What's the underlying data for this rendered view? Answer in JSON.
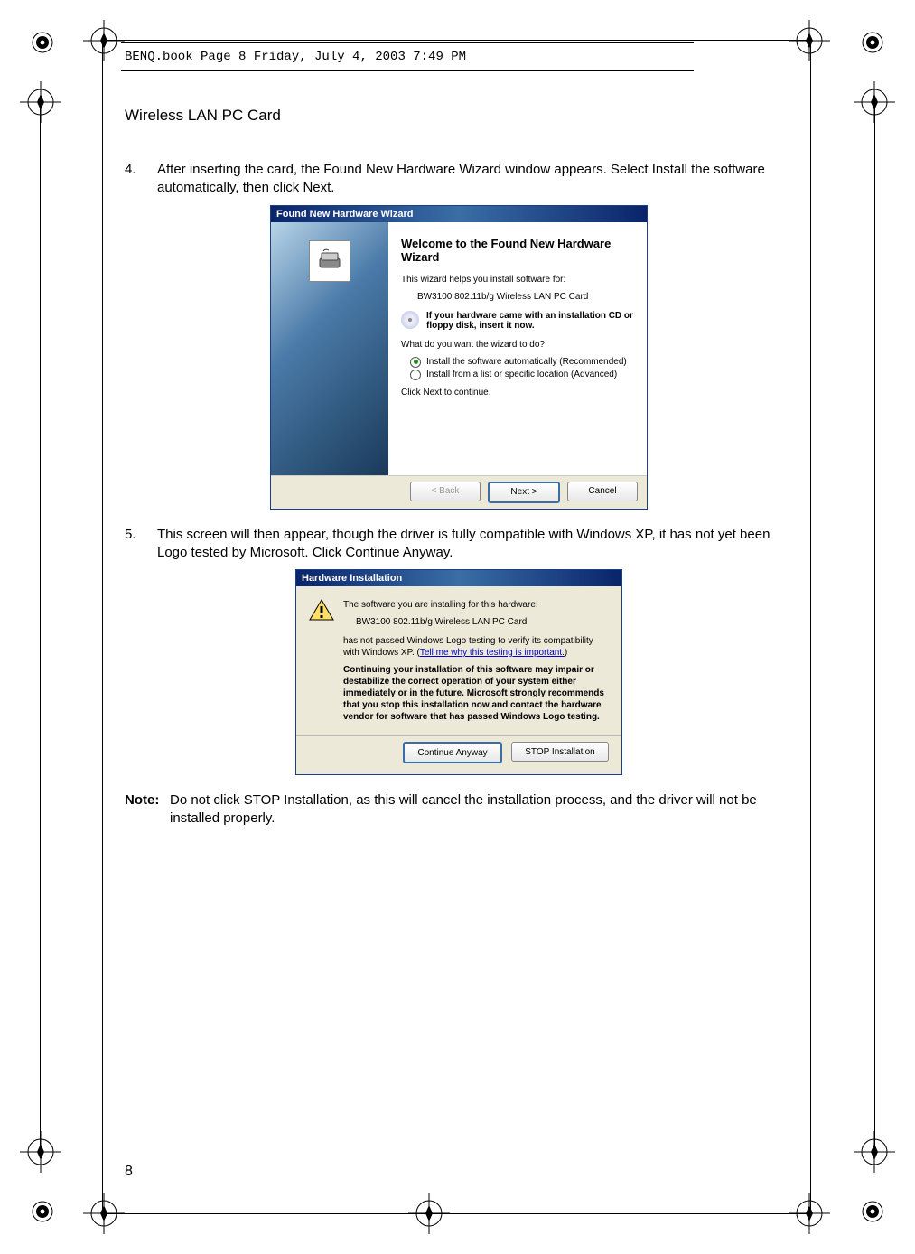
{
  "meta": {
    "header_bar": "BENQ.book  Page 8  Friday, July 4, 2003  7:49 PM"
  },
  "doc": {
    "section_title": "Wireless LAN PC Card",
    "page_number": "8"
  },
  "step4": {
    "num": "4.",
    "text": "After inserting the card, the Found New Hardware Wizard window appears. Select Install the software automatically, then click Next."
  },
  "wizard": {
    "title": "Found New Hardware Wizard",
    "heading": "Welcome to the Found New Hardware Wizard",
    "intro": "This wizard helps you install software for:",
    "device": "BW3100 802.11b/g Wireless LAN PC Card",
    "cd_note": "If your hardware came with an installation CD or floppy disk, insert it now.",
    "question": "What do you want the wizard to do?",
    "opt1": "Install the software automatically (Recommended)",
    "opt2": "Install from a list or specific location (Advanced)",
    "continue": "Click Next to continue.",
    "back": "< Back",
    "next": "Next >",
    "cancel": "Cancel"
  },
  "step5": {
    "num": "5.",
    "text": "This screen will then appear, though the driver is fully compatible with Windows XP, it has not yet been Logo tested by Microsoft. Click Continue Anyway."
  },
  "warn": {
    "title": "Hardware Installation",
    "line1": "The software you are installing for this hardware:",
    "device": "BW3100 802.11b/g Wireless LAN PC Card",
    "line2a": "has not passed Windows Logo testing to verify its compatibility with Windows XP. (",
    "link": "Tell me why this testing is important.",
    "line2b": ")",
    "bold": "Continuing your installation of this software may impair or destabilize the correct operation of your system either immediately or in the future. Microsoft strongly recommends that you stop this installation now and contact the hardware vendor for software that has passed Windows Logo testing.",
    "continue": "Continue Anyway",
    "stop": "STOP Installation"
  },
  "note": {
    "label": "Note:",
    "text": "Do not click STOP Installation, as this will cancel the installation process, and the driver will not be installed properly."
  }
}
